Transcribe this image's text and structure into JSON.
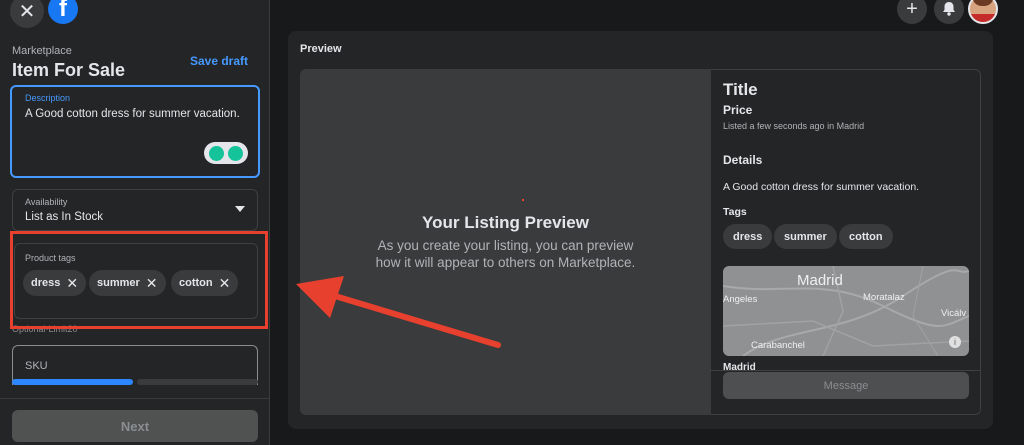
{
  "sidebar": {
    "close_icon": "close-icon",
    "logo_letter": "f",
    "breadcrumb": "Marketplace",
    "title": "Item For Sale",
    "save_draft": "Save draft",
    "description": {
      "label": "Description",
      "value": "A Good cotton dress for summer vacation."
    },
    "availability": {
      "label": "Availability",
      "value": "List as In Stock"
    },
    "product_tags": {
      "label": "Product tags",
      "tags": [
        "dress",
        "summer",
        "cotton"
      ]
    },
    "optional_hint": "Optional·Limit20",
    "sku_label": "SKU",
    "progress": 0.5,
    "next_label": "Next"
  },
  "topbar": {
    "create_icon": "plus-icon",
    "notifications_icon": "bell-icon",
    "avatar": "profile-avatar"
  },
  "preview": {
    "section_title": "Preview",
    "heading": "Your Listing Preview",
    "subtext_line1": "As you create your listing, you can preview",
    "subtext_line2": "how it will appear to others on Marketplace.",
    "details_panel": {
      "title": "Title",
      "price": "Price",
      "listed": "Listed a few seconds ago in Madrid",
      "details_heading": "Details",
      "description": "A Good cotton dress for summer vacation.",
      "tags_heading": "Tags",
      "tags": [
        "dress",
        "summer",
        "cotton"
      ],
      "map": {
        "city": "Madrid",
        "labels": [
          "Moratalaz",
          "Angeles",
          "Vicálv",
          "Carabanchel"
        ]
      },
      "location": "Madrid",
      "message_button": "Message"
    }
  },
  "colors": {
    "accent": "#4599ff",
    "annotation_red": "#e8402e",
    "progress_fill": "#2d88ff"
  }
}
